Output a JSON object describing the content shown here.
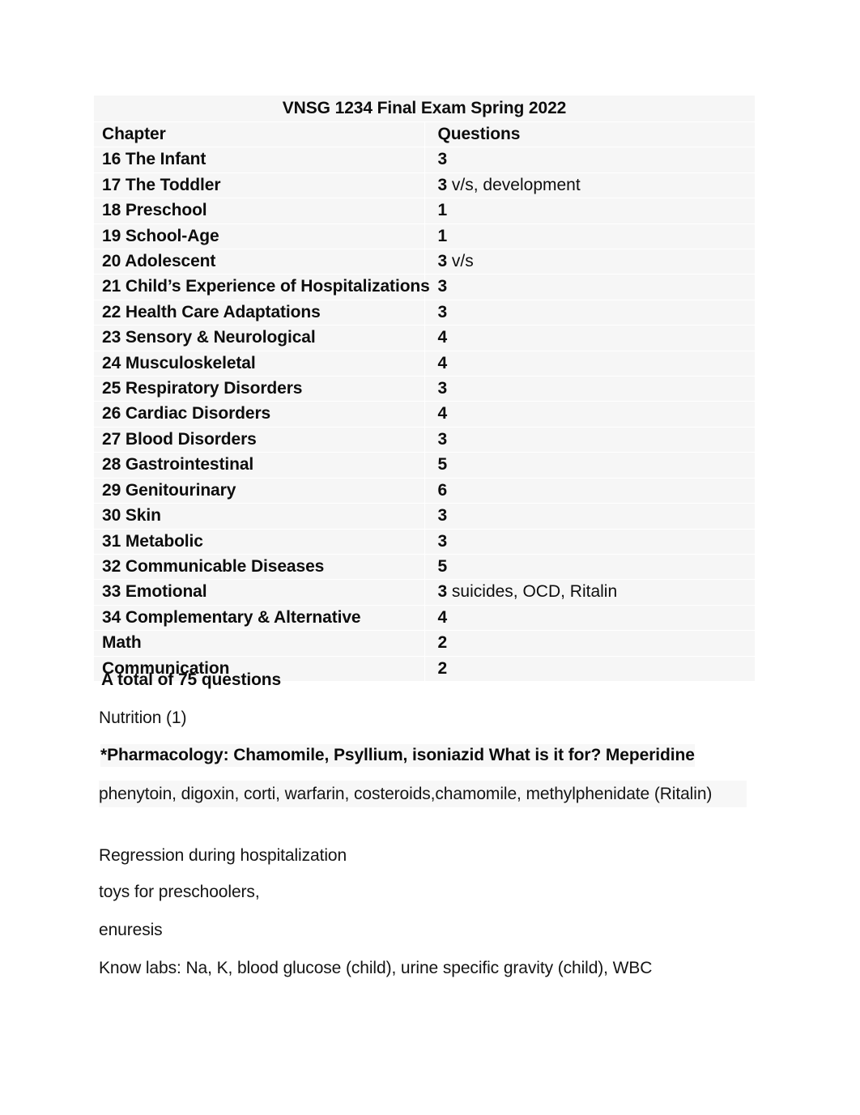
{
  "document": {
    "title": "VNSG 1234 Final Exam Spring 2022"
  },
  "table": {
    "headers": {
      "chapter": "Chapter",
      "questions": "Questions"
    },
    "rows": [
      {
        "chapter": "16 The Infant",
        "questions": "3",
        "note": ""
      },
      {
        "chapter": "17 The Toddler",
        "questions": "3",
        "note": " v/s, development"
      },
      {
        "chapter": "18 Preschool",
        "questions": "1",
        "note": ""
      },
      {
        "chapter": "19 School-Age",
        "questions": "1",
        "note": ""
      },
      {
        "chapter": "20 Adolescent",
        "questions": "3",
        "note": " v/s"
      },
      {
        "chapter": "21 Child’s Experience of Hospitalizations",
        "questions": "3",
        "note": ""
      },
      {
        "chapter": "22 Health Care Adaptations",
        "questions": "3",
        "note": ""
      },
      {
        "chapter": "23 Sensory & Neurological",
        "questions": "4",
        "note": ""
      },
      {
        "chapter": "24 Musculoskeletal",
        "questions": "4",
        "note": ""
      },
      {
        "chapter": "25 Respiratory Disorders",
        "questions": "3",
        "note": ""
      },
      {
        "chapter": "26 Cardiac Disorders",
        "questions": "4",
        "note": ""
      },
      {
        "chapter": "27 Blood Disorders",
        "questions": "3",
        "note": ""
      },
      {
        "chapter": "28 Gastrointestinal",
        "questions": "5",
        "note": ""
      },
      {
        "chapter": "29 Genitourinary",
        "questions": "6",
        "note": ""
      },
      {
        "chapter": "30 Skin",
        "questions": "3",
        "note": ""
      },
      {
        "chapter": "31 Metabolic",
        "questions": "3",
        "note": ""
      },
      {
        "chapter": "32 Communicable Diseases",
        "questions": "5",
        "note": ""
      },
      {
        "chapter": "33 Emotional",
        "questions": "3",
        "note": " suicides, OCD, Ritalin"
      },
      {
        "chapter": "34 Complementary & Alternative",
        "questions": "4",
        "note": ""
      },
      {
        "chapter": "Math",
        "questions": "2",
        "note": ""
      },
      {
        "chapter": "Communication",
        "questions": "2",
        "note": ""
      }
    ],
    "total_line": "A total of 75 questions"
  },
  "notes": {
    "nutrition": "Nutrition (1)",
    "pharmacology": "*Pharmacology: Chamomile, Psyllium, isoniazid What is it for? Meperidine",
    "medications": " phenytoin, digoxin, corti, warfarin, costeroids,chamomile, methylphenidate (Ritalin)",
    "regression": "Regression during hospitalization",
    "toys": " toys for preschoolers,",
    "enuresis": " enuresis",
    "labs": "Know labs: Na, K, blood glucose (child), urine specific gravity (child), WBC"
  }
}
